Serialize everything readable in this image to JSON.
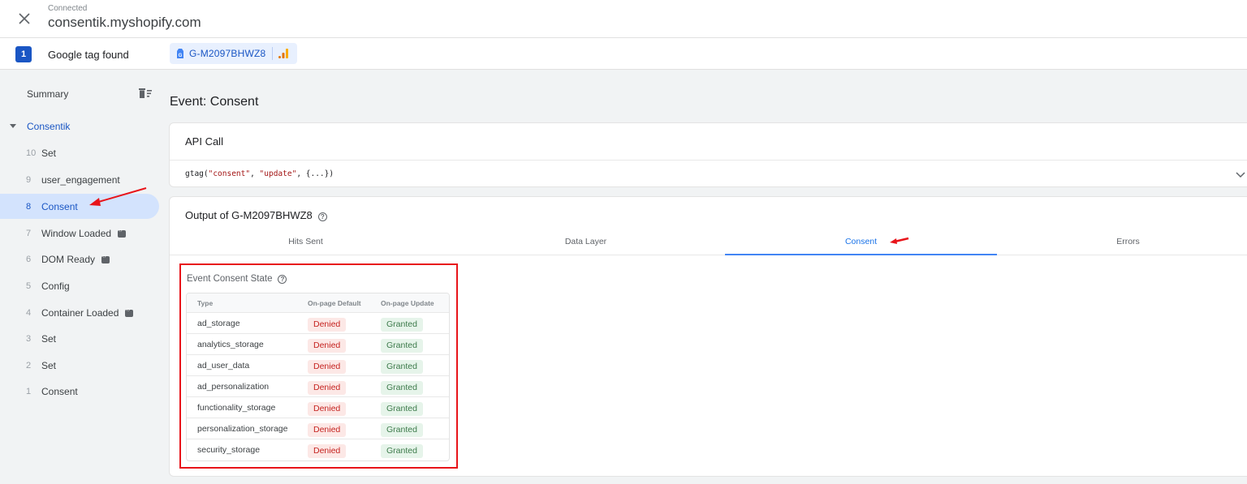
{
  "header": {
    "close_icon": "close-icon",
    "status_label": "Connected",
    "domain": "consentik.myshopify.com"
  },
  "tagbar": {
    "count": "1",
    "found_label": "Google tag found",
    "tag_id": "G-M2097BHWZ8",
    "tag_icon": "google-tag-icon",
    "analytics_icon": "analytics-bars-icon",
    "colors": {
      "accent": "#1a56c4",
      "chip_bg": "#e8f0fe"
    }
  },
  "sidebar": {
    "summary_label": "Summary",
    "clear_icon": "delete-sweep-icon",
    "group_name": "Consentik",
    "events": [
      {
        "num": "10",
        "name": "Set",
        "badge": false,
        "selected": false
      },
      {
        "num": "9",
        "name": "user_engagement",
        "badge": false,
        "selected": false
      },
      {
        "num": "8",
        "name": "Consent",
        "badge": false,
        "selected": true
      },
      {
        "num": "7",
        "name": "Window Loaded",
        "badge": true,
        "selected": false
      },
      {
        "num": "6",
        "name": "DOM Ready",
        "badge": true,
        "selected": false
      },
      {
        "num": "5",
        "name": "Config",
        "badge": false,
        "selected": false
      },
      {
        "num": "4",
        "name": "Container Loaded",
        "badge": true,
        "selected": false
      },
      {
        "num": "3",
        "name": "Set",
        "badge": false,
        "selected": false
      },
      {
        "num": "2",
        "name": "Set",
        "badge": false,
        "selected": false
      },
      {
        "num": "1",
        "name": "Consent",
        "badge": false,
        "selected": false
      }
    ]
  },
  "main": {
    "title": "Event: Consent",
    "api_call": {
      "title": "API Call",
      "code_fn": "gtag(",
      "code_arg1": "\"consent\"",
      "code_sep1": ", ",
      "code_arg2": "\"update\"",
      "code_rest": ", {...})"
    },
    "output": {
      "title": "Output of G-M2097BHWZ8",
      "help_glyph": "?",
      "tabs": [
        {
          "label": "Hits Sent",
          "active": false
        },
        {
          "label": "Data Layer",
          "active": false
        },
        {
          "label": "Consent",
          "active": true
        },
        {
          "label": "Errors",
          "active": false
        }
      ],
      "consent_state": {
        "title": "Event Consent State",
        "columns": [
          "Type",
          "On-page Default",
          "On-page Update"
        ],
        "rows": [
          {
            "type": "ad_storage",
            "default": "Denied",
            "update": "Granted"
          },
          {
            "type": "analytics_storage",
            "default": "Denied",
            "update": "Granted"
          },
          {
            "type": "ad_user_data",
            "default": "Denied",
            "update": "Granted"
          },
          {
            "type": "ad_personalization",
            "default": "Denied",
            "update": "Granted"
          },
          {
            "type": "functionality_storage",
            "default": "Denied",
            "update": "Granted"
          },
          {
            "type": "personalization_storage",
            "default": "Denied",
            "update": "Granted"
          },
          {
            "type": "security_storage",
            "default": "Denied",
            "update": "Granted"
          }
        ]
      }
    }
  },
  "annotations": {
    "highlight_color": "#e8141a"
  }
}
